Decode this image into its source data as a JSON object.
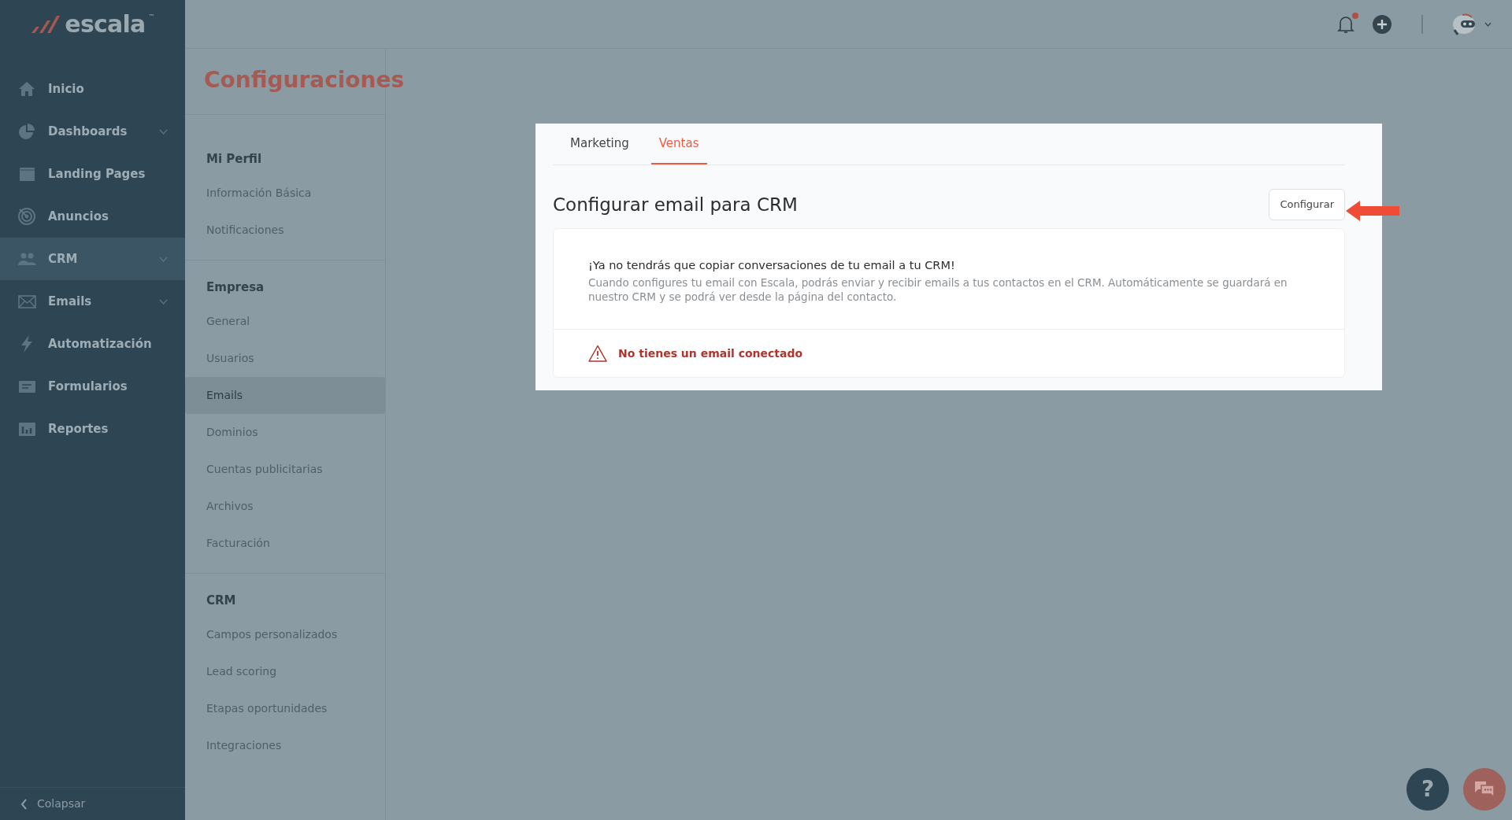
{
  "logo": {
    "text": "escala",
    "mark": "™"
  },
  "sidebar": {
    "items": [
      {
        "label": "Inicio",
        "kind": "home",
        "expandable": false,
        "selected": false
      },
      {
        "label": "Dashboards",
        "kind": "pie",
        "expandable": true,
        "selected": false
      },
      {
        "label": "Landing Pages",
        "kind": "page",
        "expandable": false,
        "selected": false
      },
      {
        "label": "Anuncios",
        "kind": "target",
        "expandable": false,
        "selected": false
      },
      {
        "label": "CRM",
        "kind": "people",
        "expandable": true,
        "selected": true
      },
      {
        "label": "Emails",
        "kind": "mail",
        "expandable": true,
        "selected": false
      },
      {
        "label": "Automatización",
        "kind": "bolt",
        "expandable": false,
        "selected": false
      },
      {
        "label": "Formularios",
        "kind": "form",
        "expandable": false,
        "selected": false
      },
      {
        "label": "Reportes",
        "kind": "chart",
        "expandable": false,
        "selected": false
      }
    ],
    "collapse": "Colapsar"
  },
  "header": {
    "notification_badge": true
  },
  "page_title": "Configuraciones",
  "settings_menu": [
    {
      "heading": "Mi Perfil",
      "items": [
        {
          "label": "Información Básica",
          "selected": false
        },
        {
          "label": "Notificaciones",
          "selected": false
        }
      ]
    },
    {
      "heading": "Empresa",
      "items": [
        {
          "label": "General",
          "selected": false
        },
        {
          "label": "Usuarios",
          "selected": false
        },
        {
          "label": "Emails",
          "selected": true
        },
        {
          "label": "Dominios",
          "selected": false
        },
        {
          "label": "Cuentas publicitarias",
          "selected": false
        },
        {
          "label": "Archivos",
          "selected": false
        },
        {
          "label": "Facturación",
          "selected": false
        }
      ]
    },
    {
      "heading": "CRM",
      "items": [
        {
          "label": "Campos personalizados",
          "selected": false
        },
        {
          "label": "Lead scoring",
          "selected": false
        },
        {
          "label": "Etapas oportunidades",
          "selected": false
        },
        {
          "label": "Integraciones",
          "selected": false
        }
      ]
    }
  ],
  "panel": {
    "tabs": [
      {
        "label": "Marketing",
        "selected": false
      },
      {
        "label": "Ventas",
        "selected": true
      }
    ],
    "title": "Configurar email para CRM",
    "button": "Configurar",
    "headline": "¡Ya no tendrás que copiar conversaciones de tu email a tu CRM!",
    "description": "Cuando configures tu email con Escala, podrás enviar y recibir emails a tus contactos en el CRM. Automáticamente se guardará en nuestro CRM y se podrá ver desde la página del contacto.",
    "warning": "No tienes un email conectado"
  },
  "help": "?"
}
